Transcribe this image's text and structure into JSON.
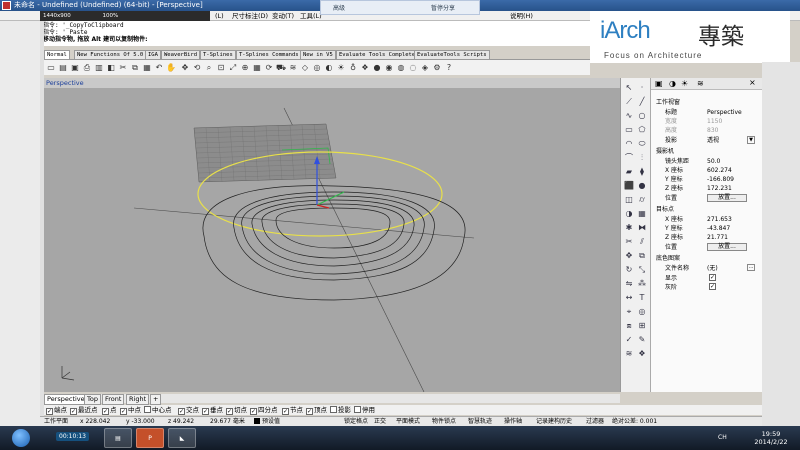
{
  "window": {
    "title": "未命名 - Undefined (Undefined) (64-bit) - [Perspective]"
  },
  "recorder_bar": {
    "resolution": "1440x900",
    "zoom": "100%",
    "item_a": "高级",
    "item_b": "暂停分享"
  },
  "menu": {
    "items": [
      "(L)",
      "尺寸标注(D)",
      "变动(T)",
      "工具(L)",
      "说明(H)"
    ]
  },
  "brand": {
    "logo": "iArch",
    "name": "專築",
    "tagline": "Focus on Architecture"
  },
  "command": {
    "line1": "指令: '_CopyToClipboard",
    "line2": "指令: '_Paste",
    "prompt": "移动指令物, 拖放 Alt 建司以复制物件:"
  },
  "tabs": [
    "Normal",
    "New Functions Of 5.0",
    "IGA",
    "WeaverBird",
    "T-Splines",
    "T-Splines Commands",
    "New in V5",
    "Evaluate Tools Complete",
    "EvaluateTools Scripts"
  ],
  "viewport": {
    "label": "Perspective"
  },
  "properties": {
    "section_working": "工作视窗",
    "title_key": "标题",
    "title_val": "Perspective",
    "width_key": "宽度",
    "width_val": "1150",
    "height_key": "高度",
    "height_val": "830",
    "projection_key": "投影",
    "projection_val": "透视",
    "section_camera": "摄影机",
    "lens_key": "镜头焦距",
    "lens_val": "50.0",
    "cx_key": "X 座标",
    "cx_val": "602.274",
    "cy_key": "Y 座标",
    "cy_val": "-166.809",
    "cz_key": "Z 座标",
    "cz_val": "172.231",
    "pos_key": "位置",
    "pos_btn": "放置...",
    "section_target": "目标点",
    "tx_key": "X 座标",
    "tx_val": "271.653",
    "ty_key": "Y 座标",
    "ty_val": "-43.847",
    "tz_key": "Z 座标",
    "tz_val": "21.771",
    "tpos_key": "位置",
    "tpos_btn": "放置...",
    "section_wallpaper": "底色图案",
    "file_key": "文件名称",
    "file_val": "(无)",
    "show_key": "显示",
    "gray_key": "灰阶"
  },
  "view_tabs": [
    "Perspective",
    "Top",
    "Front",
    "Right"
  ],
  "osnap": [
    "端点",
    "最近点",
    "点",
    "中点",
    "中心点",
    "交点",
    "垂点",
    "切点",
    "四分点",
    "节点",
    "顶点",
    "投影",
    "停用"
  ],
  "status": {
    "cplane": "工作平面",
    "x": "x 228.042",
    "y": "y -33.000",
    "z": "z 49.242",
    "unit": "29.677 毫米",
    "layer": "预设值",
    "lock": "锁定格点",
    "ortho": "正交",
    "planar": "平面模式",
    "osnap": "物件锁点",
    "smart": "智慧轨迹",
    "gumball": "操作轴",
    "history": "记录建构历史",
    "filter": "过滤器",
    "tolerance": "绝对公差: 0.001"
  },
  "taskbar": {
    "rec": "00:10:13",
    "lang": "CH",
    "time": "19:59",
    "date": "2014/2/22"
  },
  "colors": {
    "viewport_bg": "#a6a6a6",
    "accent_blue": "#2d7fc1",
    "selection_yellow": "#e8e04a"
  }
}
